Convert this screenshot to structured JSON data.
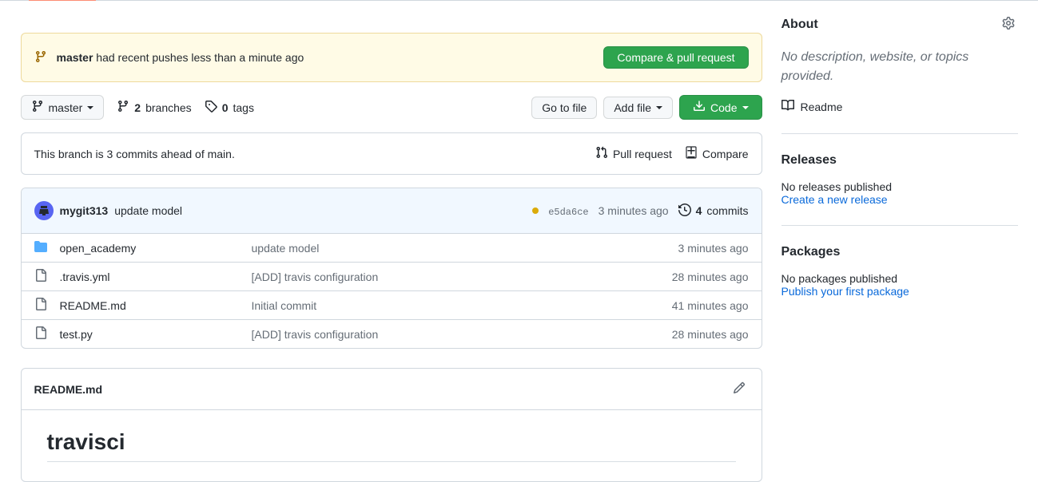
{
  "flash": {
    "branch": "master",
    "message": " had recent pushes less than a minute ago",
    "button": "Compare & pull request"
  },
  "toolbar": {
    "branch_label": "master",
    "branches_count": "2",
    "branches_label": " branches",
    "tags_count": "0",
    "tags_label": " tags",
    "goto_file": "Go to file",
    "add_file": "Add file",
    "code": "Code"
  },
  "branch_info": {
    "text": "This branch is 3 commits ahead of main.",
    "pull_request": "Pull request",
    "compare": "Compare"
  },
  "commit": {
    "author": "mygit313",
    "message": "update model",
    "sha": "e5da6ce",
    "time": "3 minutes ago",
    "commits_count": "4",
    "commits_label": " commits"
  },
  "files": [
    {
      "type": "dir",
      "name": "open_academy",
      "msg": "update model",
      "time": "3 minutes ago"
    },
    {
      "type": "file",
      "name": ".travis.yml",
      "msg": "[ADD] travis configuration",
      "time": "28 minutes ago"
    },
    {
      "type": "file",
      "name": "README.md",
      "msg": "Initial commit",
      "time": "41 minutes ago"
    },
    {
      "type": "file",
      "name": "test.py",
      "msg": "[ADD] travis configuration",
      "time": "28 minutes ago"
    }
  ],
  "readme": {
    "filename": "README.md",
    "heading": "travisci"
  },
  "about": {
    "title": "About",
    "description": "No description, website, or topics provided.",
    "readme_link": "Readme"
  },
  "releases": {
    "title": "Releases",
    "text": "No releases published",
    "link": "Create a new release"
  },
  "packages": {
    "title": "Packages",
    "text": "No packages published",
    "link": "Publish your first package"
  }
}
